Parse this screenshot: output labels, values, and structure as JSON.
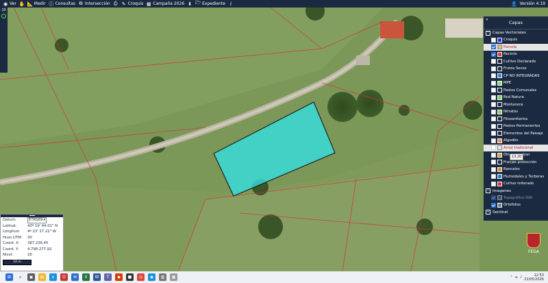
{
  "toolbar": {
    "items": [
      {
        "name": "ver",
        "label": "Ver",
        "icon": "eye-icon"
      },
      {
        "name": "hand",
        "label": "",
        "icon": "hand-icon"
      },
      {
        "name": "medir",
        "label": "Medir",
        "icon": "ruler-icon"
      },
      {
        "name": "consultas",
        "label": "Consultas",
        "icon": "info-icon"
      },
      {
        "name": "interseccion",
        "label": "Intersección",
        "icon": "intersect-icon"
      },
      {
        "name": "print",
        "label": "",
        "icon": "print-icon"
      },
      {
        "name": "croquis",
        "label": "Croquis",
        "icon": "pencil-icon"
      },
      {
        "name": "campana",
        "label": "Campaña 2026",
        "icon": "calendar-icon"
      },
      {
        "name": "download",
        "label": "",
        "icon": "download-icon"
      },
      {
        "name": "expediente",
        "label": "Expediente",
        "icon": "folder-icon"
      },
      {
        "name": "about",
        "label": "",
        "icon": "info-italic-icon"
      }
    ],
    "version": "Versión 4.19"
  },
  "left": {
    "zoom_label": "20"
  },
  "layers": {
    "title": "Capas",
    "vector_section": "Capas Vectoriales",
    "vector_layers": [
      {
        "label": "Croquis",
        "checked": false,
        "color": "#2b2be0"
      },
      {
        "label": "Parcela",
        "checked": true,
        "color": "#e0b48a",
        "highlight": true
      },
      {
        "label": "Recinto",
        "checked": true,
        "color": "#e23b3b"
      },
      {
        "label": "Cultivo Declarado",
        "checked": false,
        "color": ""
      },
      {
        "label": "Frutos Secos",
        "checked": false,
        "color": ""
      },
      {
        "label": "CP NO INTEGRADAS",
        "checked": false,
        "color": "#2d86e0"
      },
      {
        "label": "MPE",
        "checked": false,
        "color": "#8ee05a"
      },
      {
        "label": "Pastos Comunales",
        "checked": false,
        "color": ""
      },
      {
        "label": "Red Natura",
        "checked": false,
        "color": "#7dd26a"
      },
      {
        "label": "Montanera",
        "checked": false,
        "color": ""
      },
      {
        "label": "Nitratos",
        "checked": false,
        "color": "#9bc850"
      },
      {
        "label": "Fitosanitarios",
        "checked": false,
        "color": ""
      },
      {
        "label": "Pastos Permanentes",
        "checked": false,
        "color": ""
      },
      {
        "label": "Elementos del Paisaje",
        "checked": false,
        "color": ""
      },
      {
        "label": "Algodón",
        "checked": false,
        "color": "#ff8a3d"
      },
      {
        "label": "Arroz tradicional",
        "checked": false,
        "color": "",
        "highlight": true
      },
      {
        "label": "Olivar en desn",
        "checked": false,
        "color": "#cfa54a"
      },
      {
        "label": "Franjas protección",
        "checked": false,
        "color": ""
      },
      {
        "label": "Bancales",
        "checked": false,
        "color": "#e08a2d"
      },
      {
        "label": "Humedales y Turberas",
        "checked": false,
        "color": "#2d7fd0"
      },
      {
        "label": "Cultivo reiterado",
        "checked": false,
        "color": "#d23b3b"
      }
    ],
    "image_section": "Imagenes",
    "image_layers": [
      {
        "label": "Topográfico IGN",
        "checked": true,
        "dim": true
      },
      {
        "label": "Ortofotos",
        "checked": true,
        "dim": false
      }
    ],
    "sentinel": "Sentinel",
    "tooltip": "13,20"
  },
  "info": {
    "rows": [
      {
        "label": "Datum:",
        "value": "ETRS89"
      },
      {
        "label": "Latitud:",
        "value": "43º 19' 44.01\" N"
      },
      {
        "label": "Longitud:",
        "value": "4º 23' 27.22\" W"
      },
      {
        "label": "Huso UTM:",
        "value": "30"
      },
      {
        "label": "Coord. X:",
        "value": "387.236,45"
      },
      {
        "label": "Coord. Y:",
        "value": "4.798.277,92"
      },
      {
        "label": "Nivel:",
        "value": "20"
      }
    ],
    "scale": "10 m"
  },
  "logo": {
    "text": "FEGA"
  },
  "taskbar": {
    "time": "12:53",
    "date": "21/05/2026"
  }
}
